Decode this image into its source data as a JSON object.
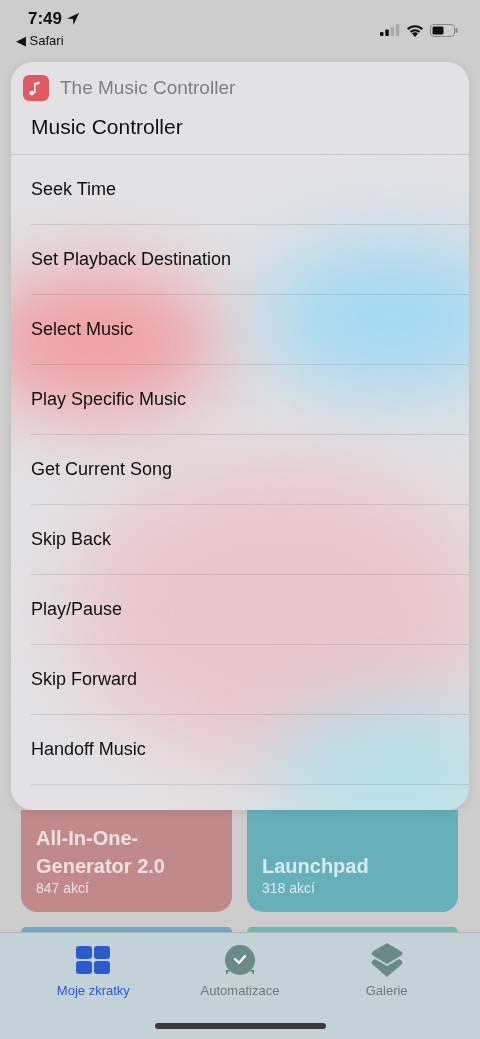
{
  "status_bar": {
    "time": "7:49",
    "back_label": "◀ Safari"
  },
  "shortcuts": [
    {
      "title": "All-In-One-Generator 2.0",
      "count": "847 akcí",
      "color": "#c0898a"
    },
    {
      "title": "Launchpad",
      "count": "318 akcí",
      "color": "#66b0ba"
    },
    {
      "color": "#6fa8c8"
    },
    {
      "color": "#6bbcad"
    }
  ],
  "sheet": {
    "app_name": "The Music Controller",
    "title": "Music Controller",
    "actions": [
      "Seek Time",
      "Set Playback Destination",
      "Select Music",
      "Play Specific Music",
      "Get Current Song",
      "Skip Back",
      "Play/Pause",
      "Skip Forward",
      "Handoff Music"
    ]
  },
  "tab_bar": [
    {
      "label": "Moje zkratky",
      "kind": "grid",
      "selected": true
    },
    {
      "label": "Automatizace",
      "kind": "clock",
      "selected": false
    },
    {
      "label": "Galerie",
      "kind": "layers",
      "selected": false
    }
  ]
}
